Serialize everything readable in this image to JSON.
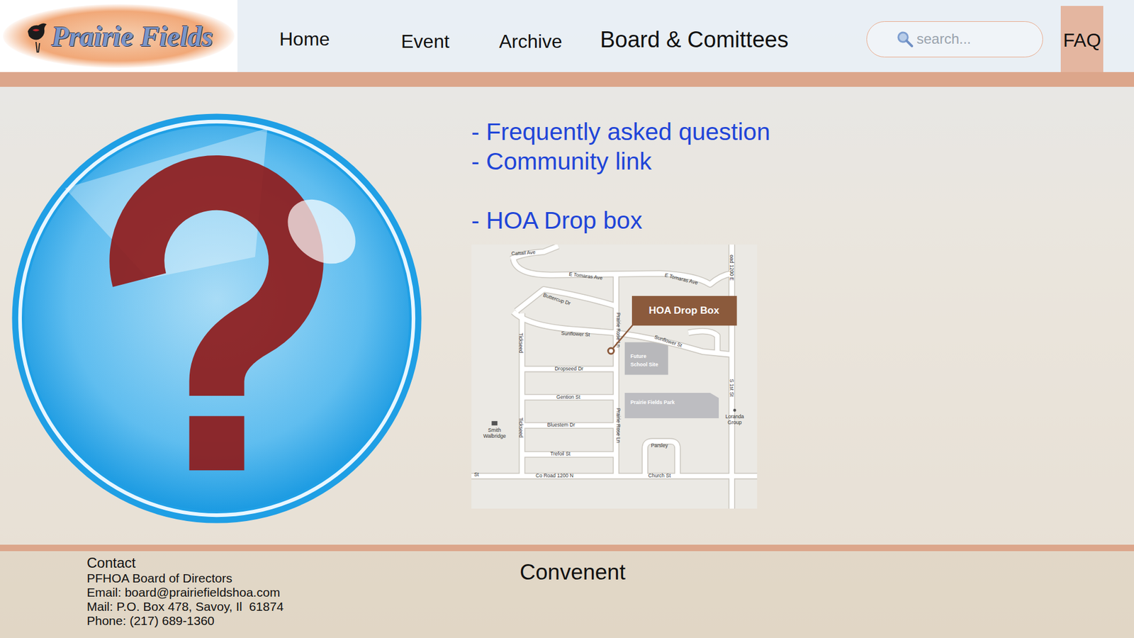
{
  "logo": {
    "text": "Prairie Fields"
  },
  "nav": [
    {
      "label": "Home",
      "selected": false
    },
    {
      "label": "Event",
      "selected": false
    },
    {
      "label": "Archive",
      "selected": false
    },
    {
      "label": "Board & Comittees",
      "selected": false
    },
    {
      "label": "FAQ",
      "selected": true
    }
  ],
  "search": {
    "placeholder": "search..."
  },
  "links": [
    "- Frequently asked question",
    "- Community link"
  ],
  "drop_box": {
    "heading": "- HOA Drop box",
    "map": {
      "callout": "HOA Drop Box",
      "labels": [
        "Cattail Ave",
        "E Tomaras Ave",
        "E Tomaras Ave",
        "Buttercup Dr",
        "Sunflower St",
        "Sunflower St",
        "Prairie Rose Ln",
        "Tickseed",
        "Dropseed Dr",
        "Gention St",
        "Bluestem Dr",
        "Trefoil St",
        "Prairie Rose Ln",
        "Tickseed",
        "Co Road 1200 N",
        "Church St",
        "St",
        "Parsley",
        "S 1st St",
        "oad 1200 E",
        "Future",
        "School Site",
        "Prairie Fields Park",
        "Loranda",
        "Group",
        "Smith",
        "Walbridge"
      ]
    }
  },
  "footer": {
    "contact": {
      "title": "Contact",
      "lines": [
        "PFHOA Board of Directors",
        "Email: board@prairiefieldshoa.com",
        "Mail: P.O. Box 478, Savoy, Il  61874",
        "Phone: (217) 689-1360"
      ]
    },
    "tagline": "Convenent"
  }
}
